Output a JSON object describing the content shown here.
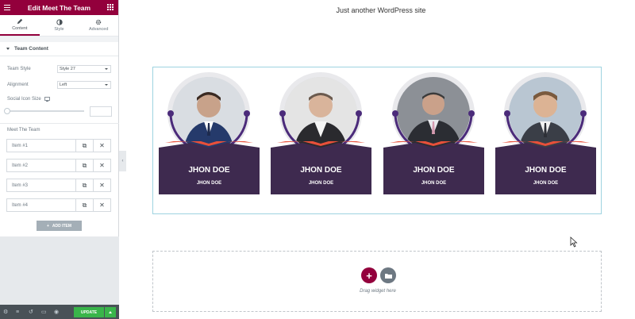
{
  "panel": {
    "title": "Edit Meet The Team",
    "tabs": [
      {
        "label": "Content",
        "icon": "pencil-icon"
      },
      {
        "label": "Style",
        "icon": "half-circle-icon"
      },
      {
        "label": "Advanced",
        "icon": "gear-icon"
      }
    ],
    "section_title": "Team Content",
    "team_style_label": "Team Style",
    "team_style_value": "Style 27",
    "alignment_label": "Alignment",
    "alignment_value": "Left",
    "social_icon_size_label": "Social Icon Size",
    "repeater_label": "Meet The Team",
    "items": [
      {
        "label": "Item #1"
      },
      {
        "label": "Item #2"
      },
      {
        "label": "Item #3"
      },
      {
        "label": "Item #4"
      }
    ],
    "add_item_label": "ADD ITEM",
    "update_label": "UPDATE"
  },
  "site": {
    "tagline": "Just another WordPress site"
  },
  "team": [
    {
      "name": "JHON DOE",
      "role": "JHON DOE"
    },
    {
      "name": "JHON DOE",
      "role": "JHON DOE"
    },
    {
      "name": "JHON DOE",
      "role": "JHON DOE"
    },
    {
      "name": "JHON DOE",
      "role": "JHON DOE"
    }
  ],
  "dropzone": {
    "text": "Drag widget here",
    "add_symbol": "+"
  },
  "colors": {
    "brand": "#93003c",
    "card_banner": "#3e2a4f",
    "card_accent": "#e8503a",
    "ring_dot": "#4b2b7a",
    "update": "#39b54a"
  }
}
